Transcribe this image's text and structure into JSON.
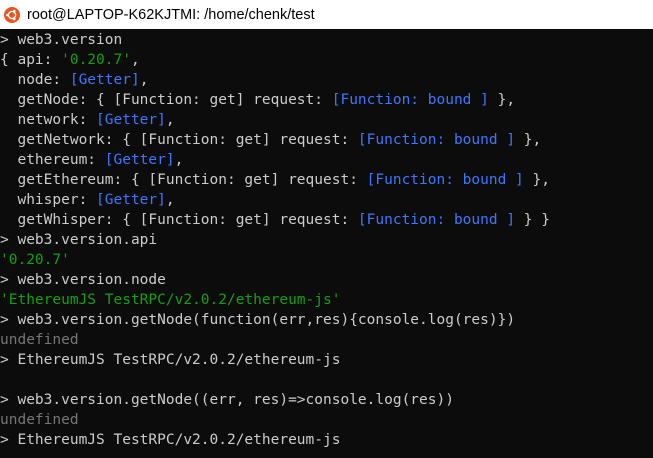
{
  "window": {
    "title": "root@LAPTOP-K62KJTMI: /home/chenk/test",
    "icon": "ubuntu-logo-icon",
    "colors": {
      "terminal_bg": "#0c0c0c",
      "text": "#cccccc",
      "string": "#13a10e",
      "special": "#3b78ff",
      "dim": "#767676",
      "ubuntu_orange": "#e95420"
    }
  },
  "terminal": {
    "lines": [
      [
        {
          "t": "> web3.version",
          "c": "default"
        }
      ],
      [
        {
          "t": "{ api: ",
          "c": "default"
        },
        {
          "t": "'0.20.7'",
          "c": "string"
        },
        {
          "t": ",",
          "c": "default"
        }
      ],
      [
        {
          "t": "  node: ",
          "c": "default"
        },
        {
          "t": "[Getter]",
          "c": "special"
        },
        {
          "t": ",",
          "c": "default"
        }
      ],
      [
        {
          "t": "  getNode: { [Function: get] request: ",
          "c": "default"
        },
        {
          "t": "[Function: bound ]",
          "c": "special"
        },
        {
          "t": " },",
          "c": "default"
        }
      ],
      [
        {
          "t": "  network: ",
          "c": "default"
        },
        {
          "t": "[Getter]",
          "c": "special"
        },
        {
          "t": ",",
          "c": "default"
        }
      ],
      [
        {
          "t": "  getNetwork: { [Function: get] request: ",
          "c": "default"
        },
        {
          "t": "[Function: bound ]",
          "c": "special"
        },
        {
          "t": " },",
          "c": "default"
        }
      ],
      [
        {
          "t": "  ethereum: ",
          "c": "default"
        },
        {
          "t": "[Getter]",
          "c": "special"
        },
        {
          "t": ",",
          "c": "default"
        }
      ],
      [
        {
          "t": "  getEthereum: { [Function: get] request: ",
          "c": "default"
        },
        {
          "t": "[Function: bound ]",
          "c": "special"
        },
        {
          "t": " },",
          "c": "default"
        }
      ],
      [
        {
          "t": "  whisper: ",
          "c": "default"
        },
        {
          "t": "[Getter]",
          "c": "special"
        },
        {
          "t": ",",
          "c": "default"
        }
      ],
      [
        {
          "t": "  getWhisper: { [Function: get] request: ",
          "c": "default"
        },
        {
          "t": "[Function: bound ]",
          "c": "special"
        },
        {
          "t": " } }",
          "c": "default"
        }
      ],
      [
        {
          "t": "> web3.version.api",
          "c": "default"
        }
      ],
      [
        {
          "t": "'0.20.7'",
          "c": "string"
        }
      ],
      [
        {
          "t": "> web3.version.node",
          "c": "default"
        }
      ],
      [
        {
          "t": "'EthereumJS TestRPC/v2.0.2/ethereum-js'",
          "c": "string"
        }
      ],
      [
        {
          "t": "> web3.version.getNode(function(err,res){console.log(res)})",
          "c": "default"
        }
      ],
      [
        {
          "t": "undefined",
          "c": "dim"
        }
      ],
      [
        {
          "t": "> EthereumJS TestRPC/v2.0.2/ethereum-js",
          "c": "default"
        }
      ],
      [
        {
          "t": "",
          "c": "default"
        }
      ],
      [
        {
          "t": "> web3.version.getNode((err, res)=>console.log(res))",
          "c": "default"
        }
      ],
      [
        {
          "t": "undefined",
          "c": "dim"
        }
      ],
      [
        {
          "t": "> EthereumJS TestRPC/v2.0.2/ethereum-js",
          "c": "default"
        }
      ]
    ]
  }
}
